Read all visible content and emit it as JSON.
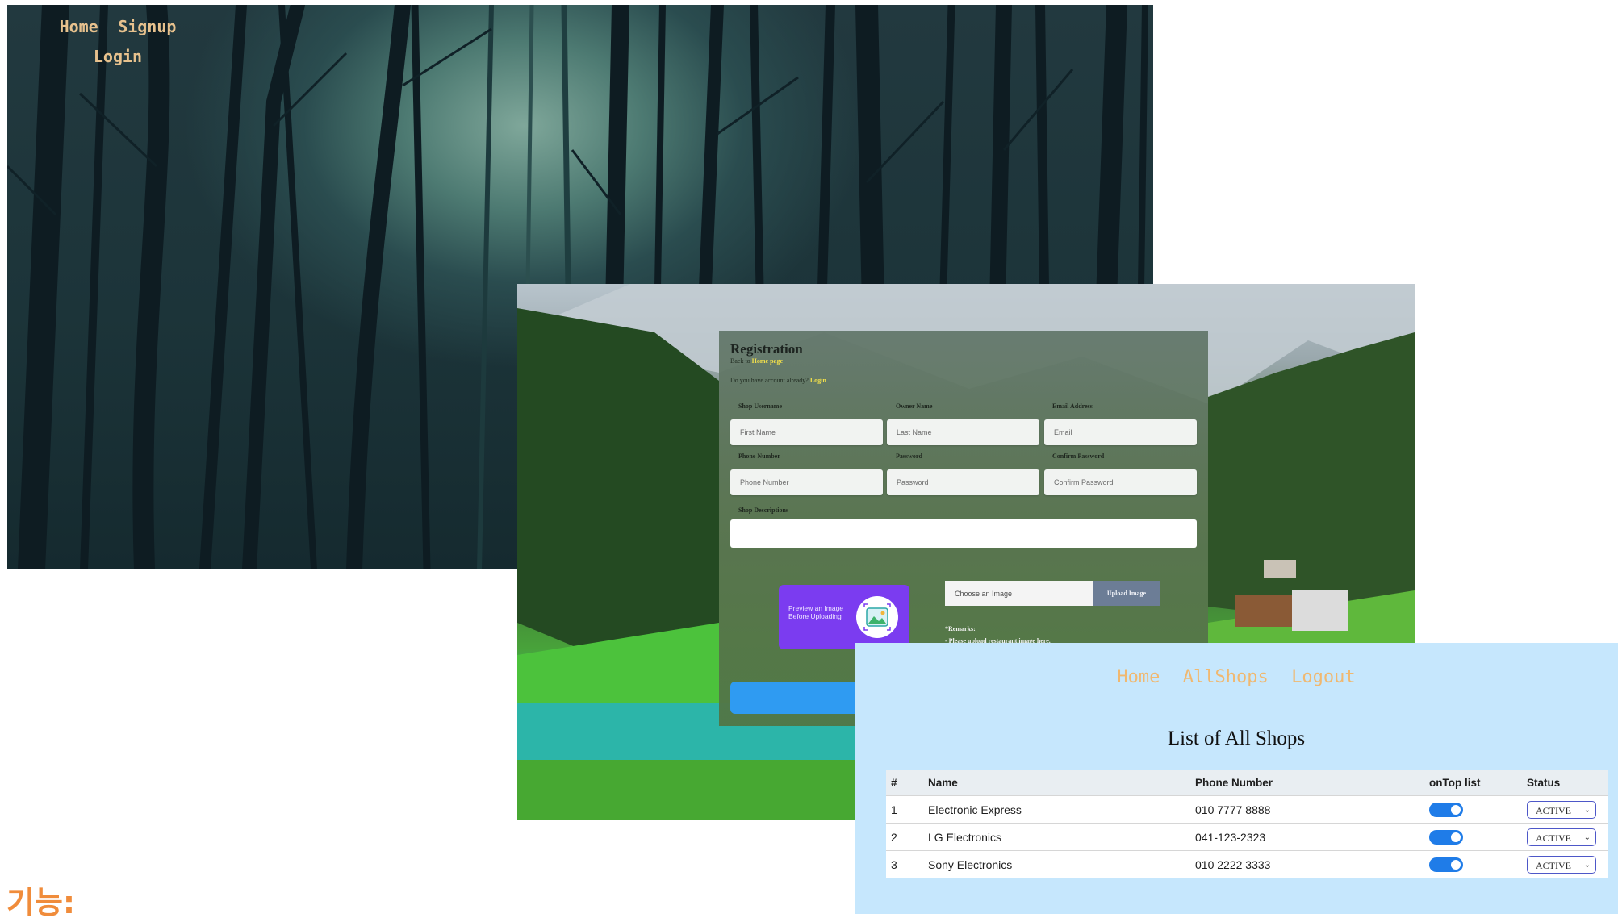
{
  "home": {
    "nav": [
      "Home",
      "Signup",
      "Login"
    ]
  },
  "registration": {
    "title": "Registration",
    "back_text": "Back to",
    "back_link": "Home page",
    "account_text": "Do you have account already?",
    "login_link": "Login",
    "fields": [
      {
        "label": "Shop Username",
        "placeholder": "First Name"
      },
      {
        "label": "Owner Name",
        "placeholder": "Last Name"
      },
      {
        "label": "Email Address",
        "placeholder": "Email"
      },
      {
        "label": "Phone Number",
        "placeholder": "Phone Number"
      },
      {
        "label": "Password",
        "placeholder": "Password"
      },
      {
        "label": "Confirm Password",
        "placeholder": "Confirm Password"
      }
    ],
    "description_label": "Shop Descriptions",
    "preview_text": "Preview an Image Before Uploading",
    "choose_placeholder": "Choose an Image",
    "upload_button": "Upload Image",
    "remarks_title": "*Remarks:",
    "remarks_line": "- Please upload restaurant image here."
  },
  "admin": {
    "nav": [
      "Home",
      "AllShops",
      "Logout"
    ],
    "title": "List of All Shops",
    "columns": [
      "#",
      "Name",
      "Phone Number",
      "onTop list",
      "Status"
    ],
    "rows": [
      {
        "num": "1",
        "name": "Electronic Express",
        "phone": "010 7777 8888",
        "on_top": true,
        "status": "ACTIVE"
      },
      {
        "num": "2",
        "name": "LG Electronics",
        "phone": "041-123-2323",
        "on_top": true,
        "status": "ACTIVE"
      },
      {
        "num": "3",
        "name": "Sony Electronics",
        "phone": "010 2222 3333",
        "on_top": true,
        "status": "ACTIVE"
      }
    ]
  },
  "caption": "기능:",
  "colors": {
    "nav_link": "#e7c18d",
    "admin_bg": "#c6e7fd",
    "caption": "#f08c3b",
    "toggle_on": "#1f7ce8",
    "preview_purple": "#7b3cf0",
    "submit_blue": "#2f9bf2"
  }
}
